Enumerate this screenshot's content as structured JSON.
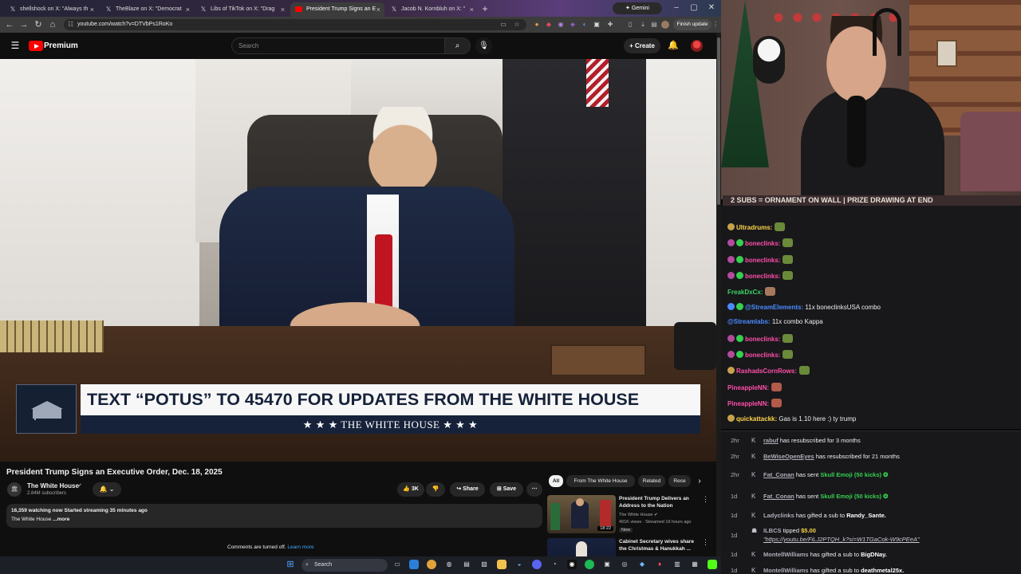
{
  "browser": {
    "tabs": [
      {
        "label": "shellshock on X: \"Always th",
        "icon": "x-logo-icon"
      },
      {
        "label": "TheBlaze on X: \"Democrat",
        "icon": "x-logo-icon"
      },
      {
        "label": "Libs of TikTok on X: \"Drag",
        "icon": "x-logo-icon"
      },
      {
        "label": "President Trump Signs an E",
        "icon": "youtube-icon",
        "active": true
      },
      {
        "label": "Jacob N. Kornbluh on X: \"",
        "icon": "x-logo-icon"
      }
    ],
    "new_tab": "+",
    "gemini_label": "Gemini",
    "url": "youtube.com/watch?v=DTVbPs1RoKo",
    "finish_update": "Finish update"
  },
  "youtube": {
    "brand": "Premium",
    "search_placeholder": "Search",
    "create_label": "Create",
    "video": {
      "title": "President Trump Signs an Executive Order, Dec. 18, 2025",
      "channel": "The White House",
      "subscribers": "2.84M subscribers",
      "likes": "3K",
      "share": "Share",
      "save": "Save",
      "watching": "16,359 watching now",
      "started": "Started streaming 35 minutes ago",
      "desc_channel": "The White House",
      "more": "...more",
      "comments_off": "Comments are turned off.",
      "learn_more": "Learn more"
    },
    "lower_third": {
      "headline": "TEXT “POTUS” TO 45470 FOR UPDATES FROM THE WHITE HOUSE",
      "footer": "★ ★ ★   THE WHITE HOUSE   ★ ★ ★"
    },
    "chips": [
      "All",
      "From The White House",
      "Related",
      "Rece"
    ],
    "recommendations": [
      {
        "title": "President Trump Delivers an Address to the Nation",
        "channel": "The White House",
        "meta": "491K views · Streamed 16 hours ago",
        "badge": "New",
        "duration": "18:22"
      },
      {
        "title": "Cabinet Secretary wives share the Christmas & Hanukkah ...",
        "channel": "",
        "meta": "",
        "badge": "",
        "duration": ""
      }
    ]
  },
  "taskbar": {
    "search_label": "Search"
  },
  "stream": {
    "banner": "2 SUBS = ORNAMENT ON WALL | PRIZE DRAWING AT END",
    "chat": [
      {
        "user": "Ultradrums:",
        "text": "",
        "color": "#ffd54a"
      },
      {
        "user": "boneclinks:",
        "text": "",
        "color": "#ff4fa8"
      },
      {
        "user": "boneclinks:",
        "text": "",
        "color": "#ff4fa8"
      },
      {
        "user": "boneclinks:",
        "text": "",
        "color": "#ff4fa8"
      },
      {
        "user": "FreakDxCx:",
        "text": "",
        "color": "#3ad364"
      },
      {
        "user": "@StreamElements:",
        "text": "11x boneclinksUSA combo",
        "color": "#4a8cff"
      },
      {
        "user": "@Streamlabs:",
        "text": "11x    combo Kappa",
        "color": "#4a8cff"
      },
      {
        "user": "boneclinks:",
        "text": "",
        "color": "#ff4fa8"
      },
      {
        "user": "boneclinks:",
        "text": "",
        "color": "#ff4fa8"
      },
      {
        "user": "RashadsCornRows:",
        "text": "",
        "color": "#ff4fa8"
      },
      {
        "user": "PineappleNN:",
        "text": "",
        "color": "#ff4fa8"
      },
      {
        "user": "PineappleNN:",
        "text": "",
        "color": "#ff4fa8"
      },
      {
        "user": "quickattackk:",
        "text": "Gas is 1.10 here :) ty trump",
        "color": "#ffd54a"
      }
    ],
    "events": [
      {
        "time": "2hr",
        "user": "rabuf",
        "text": "has resubscribed for 3 months"
      },
      {
        "time": "2hr",
        "user": "BeWiseOpenEyes",
        "text": "has resubscribed for 21 months"
      },
      {
        "time": "2hr",
        "user": "Fat_Conan",
        "text": "has sent",
        "gift": "Skull Emoji (50 kicks)"
      },
      {
        "time": "1d",
        "user": "Fat_Conan",
        "text": "has sent",
        "gift": "Skull Emoji (50 kicks)"
      },
      {
        "time": "1d",
        "user": "Ladyclinks",
        "text": "has gifted a sub to",
        "target": "Randy_Sante."
      },
      {
        "time": "1d",
        "user": "ILBCS",
        "text": "tipped",
        "amount": "$5.00",
        "link": "\"https://youtu.be/FiLJ2PTQH_k?si=W1TGaCok-W9cPEeA\""
      },
      {
        "time": "1d",
        "user": "MontellWilliams",
        "text": "has gifted a sub to",
        "target": "BigDNay."
      },
      {
        "time": "1d",
        "user": "MontellWilliams",
        "text": "has gifted a sub to",
        "target": "deathmetal25x."
      }
    ]
  }
}
